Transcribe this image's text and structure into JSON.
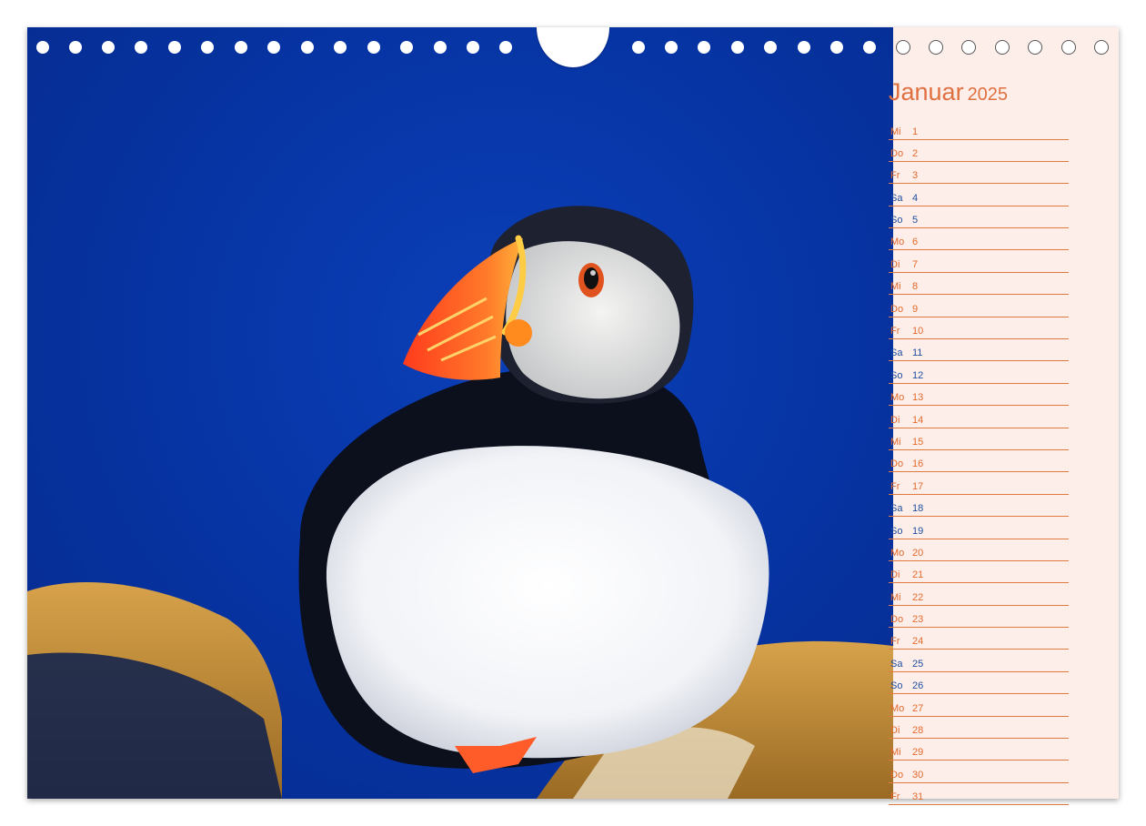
{
  "calendar": {
    "month": "Januar",
    "year": "2025",
    "days": [
      {
        "wd": "Mi",
        "n": "1",
        "type": "weekday"
      },
      {
        "wd": "Do",
        "n": "2",
        "type": "weekday"
      },
      {
        "wd": "Fr",
        "n": "3",
        "type": "weekday"
      },
      {
        "wd": "Sa",
        "n": "4",
        "type": "weekend"
      },
      {
        "wd": "So",
        "n": "5",
        "type": "weekend"
      },
      {
        "wd": "Mo",
        "n": "6",
        "type": "weekday"
      },
      {
        "wd": "Di",
        "n": "7",
        "type": "weekday"
      },
      {
        "wd": "Mi",
        "n": "8",
        "type": "weekday"
      },
      {
        "wd": "Do",
        "n": "9",
        "type": "weekday"
      },
      {
        "wd": "Fr",
        "n": "10",
        "type": "weekday"
      },
      {
        "wd": "Sa",
        "n": "11",
        "type": "weekend"
      },
      {
        "wd": "So",
        "n": "12",
        "type": "weekend"
      },
      {
        "wd": "Mo",
        "n": "13",
        "type": "weekday"
      },
      {
        "wd": "Di",
        "n": "14",
        "type": "weekday"
      },
      {
        "wd": "Mi",
        "n": "15",
        "type": "weekday"
      },
      {
        "wd": "Do",
        "n": "16",
        "type": "weekday"
      },
      {
        "wd": "Fr",
        "n": "17",
        "type": "weekday"
      },
      {
        "wd": "Sa",
        "n": "18",
        "type": "weekend"
      },
      {
        "wd": "So",
        "n": "19",
        "type": "weekend"
      },
      {
        "wd": "Mo",
        "n": "20",
        "type": "weekday"
      },
      {
        "wd": "Di",
        "n": "21",
        "type": "weekday"
      },
      {
        "wd": "Mi",
        "n": "22",
        "type": "weekday"
      },
      {
        "wd": "Do",
        "n": "23",
        "type": "weekday"
      },
      {
        "wd": "Fr",
        "n": "24",
        "type": "weekday"
      },
      {
        "wd": "Sa",
        "n": "25",
        "type": "weekend"
      },
      {
        "wd": "So",
        "n": "26",
        "type": "weekend"
      },
      {
        "wd": "Mo",
        "n": "27",
        "type": "weekday"
      },
      {
        "wd": "Di",
        "n": "28",
        "type": "weekday"
      },
      {
        "wd": "Mi",
        "n": "29",
        "type": "weekday"
      },
      {
        "wd": "Do",
        "n": "30",
        "type": "weekday"
      },
      {
        "wd": "Fr",
        "n": "31",
        "type": "weekday"
      }
    ]
  },
  "colors": {
    "weekday": "#e26a2c",
    "weekend": "#1f4fa0",
    "sky": "#0736a8",
    "sidebar": "#fdeeea"
  },
  "photo": {
    "subject_icon": "puffin-bird-image"
  }
}
